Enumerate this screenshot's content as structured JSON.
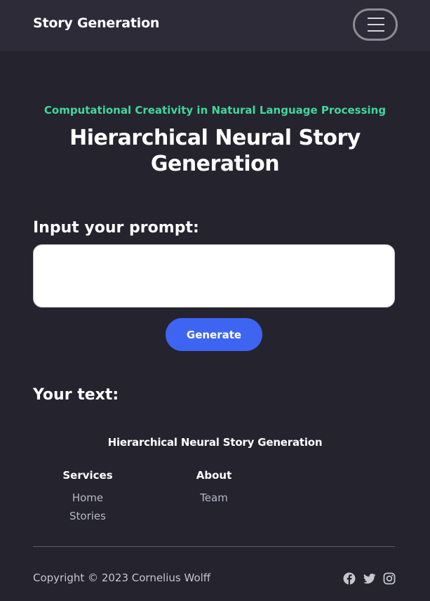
{
  "navbar": {
    "brand": "Story Generation",
    "menu_icon": "hamburger-menu-icon"
  },
  "hero": {
    "eyebrow": "Computational Creativity in Natural Language Processing",
    "title": "Hierarchical Neural Story Generation"
  },
  "prompt": {
    "label": "Input your prompt:",
    "value": "",
    "placeholder": ""
  },
  "generate_button": {
    "label": "Generate"
  },
  "output": {
    "label": "Your text:"
  },
  "footer": {
    "title": "Hierarchical Neural Story Generation",
    "services": {
      "heading": "Services",
      "links": [
        "Home",
        "Stories"
      ]
    },
    "about": {
      "heading": "About",
      "links": [
        "Team"
      ]
    },
    "copyright": "Copyright © 2023 Cornelius Wolff",
    "social_icons": [
      "facebook-icon",
      "twitter-icon",
      "instagram-icon"
    ]
  },
  "colors": {
    "background": "#24232e",
    "navbar": "#2c2b37",
    "accent_green": "#3fd998",
    "button_blue": "#3e64f2",
    "link_gray": "#b8b9c7"
  }
}
